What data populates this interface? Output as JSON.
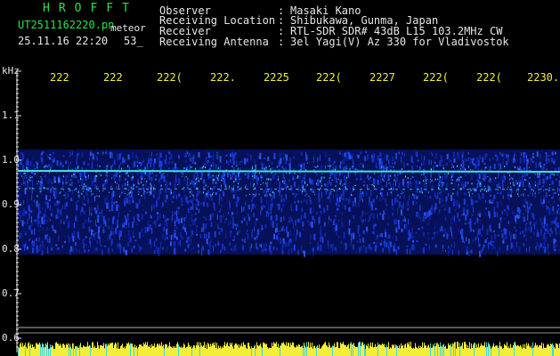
{
  "header": {
    "logo": "HROFFT",
    "filename": "UT2511162220.pn",
    "mode": "meteor",
    "datetime": "25.11.16 22:20",
    "frame": "53_",
    "info": [
      {
        "label": "Observer",
        "value": "Masaki Kano"
      },
      {
        "label": "Receiving Location",
        "value": "Shibukawa, Gunma, Japan"
      },
      {
        "label": "Receiver",
        "value": "RTL-SDR SDR# 43dB L15 103.2MHz CW"
      },
      {
        "label": "Receiving Antenna",
        "value": "3el Yagi(V) Az 330 for Vladivostok"
      }
    ]
  },
  "plot": {
    "unit": "kHz",
    "y_ticks": [
      "1.1",
      "1.0",
      "0.9",
      "0.8",
      "0.7",
      "0.6"
    ],
    "time_ticks": [
      "222",
      "222",
      "222(",
      "222.",
      "2225",
      "222(",
      "2227",
      "222(",
      "222(",
      "2230."
    ]
  },
  "colors": {
    "header_green": "#29e24a",
    "text_white": "#e6e6e6",
    "tick_yellow": "#f2ee3a",
    "noise_blue": "#1a3fe0",
    "signal_cyan": "#3fe6d8"
  }
}
